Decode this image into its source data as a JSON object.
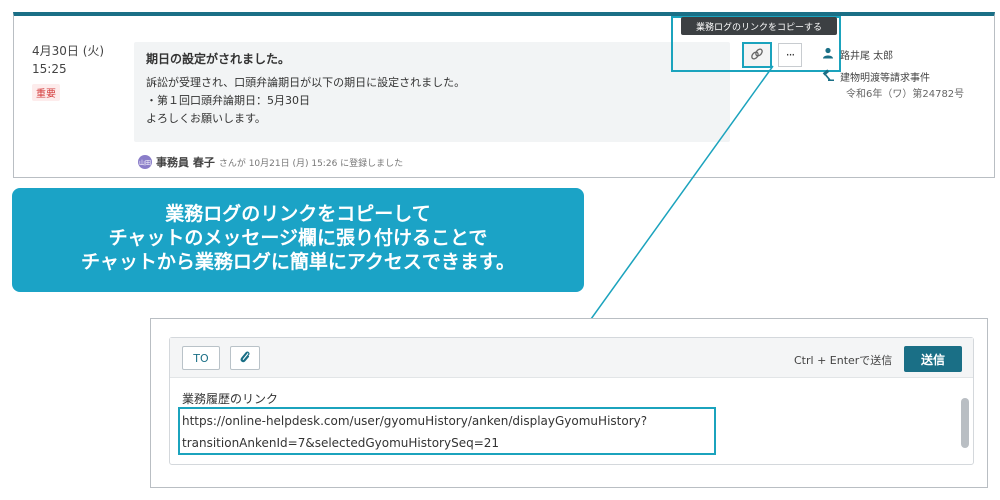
{
  "log_entry": {
    "date": "4月30日 (火)",
    "time": "15:25",
    "badge": "重要",
    "title": "期日の設定がされました。",
    "body_lines": [
      "訴訟が受理され、口頭弁論期日が以下の期日に設定されました。",
      "・第１回口頭弁論期日：5月30日",
      "よろしくお願いします。"
    ],
    "registered": {
      "avatar_text": "山田",
      "name": "事務員 春子",
      "suffix": "さんが 10月21日 (月) 15:26 に登録しました"
    }
  },
  "actions": {
    "tooltip": "業務ログのリンクをコピーする",
    "link_icon": "link-icon",
    "more_label": "···"
  },
  "side_info": {
    "person": "路井尾 太郎",
    "case_name": "建物明渡等請求事件",
    "case_number": "令和6年（ワ）第24782号"
  },
  "callout": {
    "lines": [
      "業務ログのリンクをコピーして",
      "チャットのメッセージ欄に張り付けることで",
      "チャットから業務ログに簡単にアクセスできます。"
    ]
  },
  "chat": {
    "to_label": "TO",
    "attach_icon": "paperclip-icon",
    "send_hint": "Ctrl + Enterで送信",
    "send_label": "送信",
    "message_lines": [
      "業務履歴のリンク",
      "https://online-helpdesk.com/user/gyomuHistory/anken/displayGyomuHistory?",
      "transitionAnkenId=7&selectedGyomuHistorySeq=21"
    ]
  },
  "colors": {
    "accent": "#1a6f86",
    "highlight": "#1ba3bd",
    "callout_bg": "#1ba3c6",
    "important": "#d33b3b"
  }
}
